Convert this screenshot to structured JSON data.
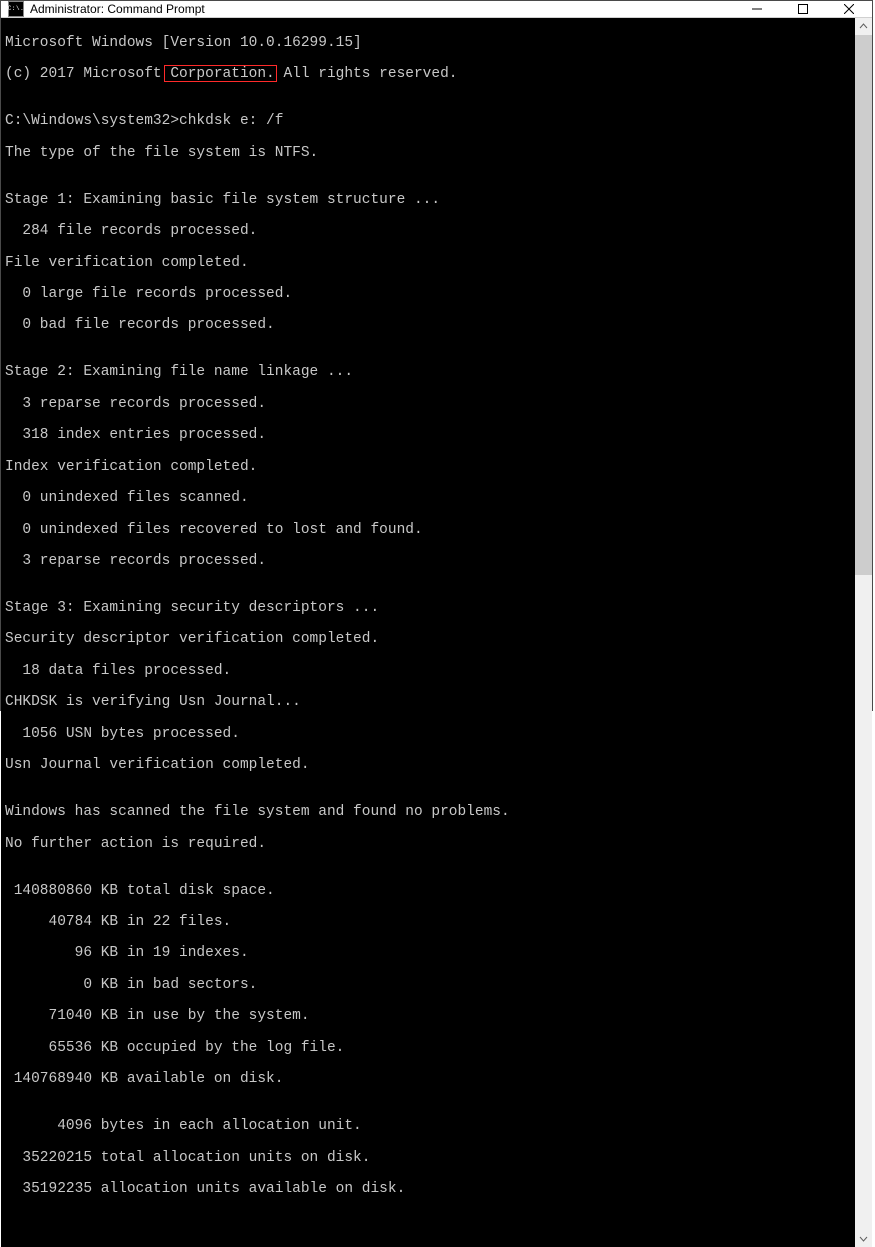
{
  "window": {
    "title": "Administrator: Command Prompt",
    "app_icon_label": "C:\\."
  },
  "prompt": {
    "path": "C:\\Windows\\system32>",
    "command": "chkdsk e: /f"
  },
  "lines": {
    "l0": "Microsoft Windows [Version 10.0.16299.15]",
    "l1": "(c) 2017 Microsoft Corporation. All rights reserved.",
    "l2": "",
    "l3_path": "C:\\Windows\\system32>",
    "l3_cmd": "chkdsk e: /f",
    "l4": "The type of the file system is NTFS.",
    "l5": "",
    "l6": "Stage 1: Examining basic file system structure ...",
    "l7": "  284 file records processed.",
    "l8": "File verification completed.",
    "l9": "  0 large file records processed.",
    "l10": "  0 bad file records processed.",
    "l11": "",
    "l12": "Stage 2: Examining file name linkage ...",
    "l13": "  3 reparse records processed.",
    "l14": "  318 index entries processed.",
    "l15": "Index verification completed.",
    "l16": "  0 unindexed files scanned.",
    "l17": "  0 unindexed files recovered to lost and found.",
    "l18": "  3 reparse records processed.",
    "l19": "",
    "l20": "Stage 3: Examining security descriptors ...",
    "l21": "Security descriptor verification completed.",
    "l22": "  18 data files processed.",
    "l23": "CHKDSK is verifying Usn Journal...",
    "l24": "  1056 USN bytes processed.",
    "l25": "Usn Journal verification completed.",
    "l26": "",
    "l27": "Windows has scanned the file system and found no problems.",
    "l28": "No further action is required.",
    "l29": "",
    "l30": " 140880860 KB total disk space.",
    "l31": "     40784 KB in 22 files.",
    "l32": "        96 KB in 19 indexes.",
    "l33": "         0 KB in bad sectors.",
    "l34": "     71040 KB in use by the system.",
    "l35": "     65536 KB occupied by the log file.",
    "l36": " 140768940 KB available on disk.",
    "l37": "",
    "l38": "      4096 bytes in each allocation unit.",
    "l39": "  35220215 total allocation units on disk.",
    "l40": "  35192235 allocation units available on disk."
  }
}
